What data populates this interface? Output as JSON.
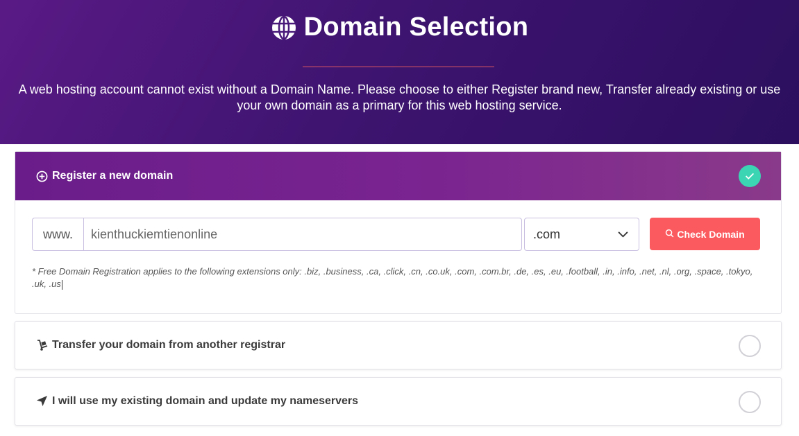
{
  "header": {
    "title": "Domain Selection",
    "icon": "globe-icon",
    "description": "A web hosting account cannot exist without a Domain Name. Please choose to either Register brand new, Transfer already existing or use your own domain as a primary for this web hosting service."
  },
  "register": {
    "label": "Register a new domain",
    "icon": "plus-circle-icon",
    "selected": true,
    "prefix": "www.",
    "domain_value": "kienthuckiemtienonline",
    "tld_selected": ".com",
    "check_button_label": "Check Domain",
    "note": "* Free Domain Registration applies to the following extensions only: .biz, .business, .ca, .click, .cn, .co.uk, .com, .com.br, .de, .es, .eu, .football, .in, .info, .net, .nl, .org, .space, .tokyo, .uk, .us"
  },
  "options": {
    "transfer": {
      "label": "Transfer your domain from another registrar",
      "icon": "dolly-icon",
      "selected": false
    },
    "existing": {
      "label": "I will use my existing domain and update my nameservers",
      "icon": "paper-plane-icon",
      "selected": false
    }
  },
  "colors": {
    "hero_start": "#5a1a86",
    "hero_end": "#2c0f5e",
    "accent_red": "#fb5a5f",
    "check_green": "#3cd5b4"
  }
}
